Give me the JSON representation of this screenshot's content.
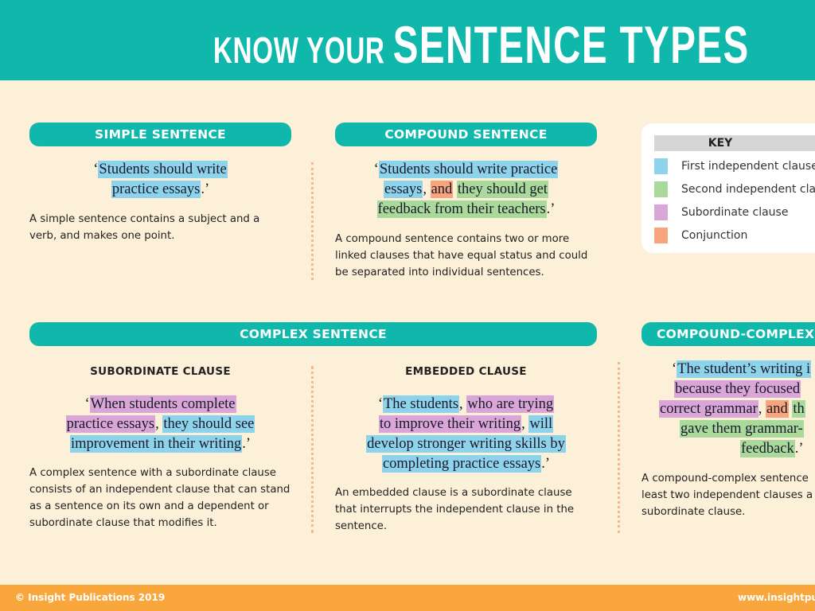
{
  "header": {
    "title_small": "KNOW YOUR",
    "title_large": "SENTENCE TYPES"
  },
  "colors": {
    "teal": "#10b8ab",
    "background": "#fdf0d9",
    "first_independent": "#8ed3ec",
    "second_independent": "#a9d99b",
    "subordinate": "#d9a6d7",
    "conjunction": "#f7a57c",
    "footer": "#f9a73c"
  },
  "simple": {
    "heading": "SIMPLE SENTENCE",
    "quote": [
      [
        {
          "t": "‘",
          "c": ""
        },
        {
          "t": "Students should write",
          "c": "first"
        }
      ],
      [
        {
          "t": "practice essays",
          "c": "first"
        },
        {
          "t": ".’",
          "c": ""
        }
      ]
    ],
    "description": "A simple sentence contains a subject and a verb, and makes one point."
  },
  "compound": {
    "heading": "COMPOUND SENTENCE",
    "quote": [
      [
        {
          "t": "‘",
          "c": ""
        },
        {
          "t": "Students should write practice",
          "c": "first"
        }
      ],
      [
        {
          "t": "essays",
          "c": "first"
        },
        {
          "t": ", ",
          "c": ""
        },
        {
          "t": "and",
          "c": "conj"
        },
        {
          "t": " ",
          "c": ""
        },
        {
          "t": "they should get",
          "c": "second"
        }
      ],
      [
        {
          "t": "feedback from their teachers",
          "c": "second"
        },
        {
          "t": ".’",
          "c": ""
        }
      ]
    ],
    "description": "A compound sentence contains two or more linked clauses that have equal status and could be separated into individual sentences."
  },
  "key": {
    "heading": "KEY",
    "items": [
      {
        "label": "First independent clause",
        "c": "first"
      },
      {
        "label": "Second independent clause",
        "c": "second"
      },
      {
        "label": "Subordinate clause",
        "c": "sub"
      },
      {
        "label": "Conjunction",
        "c": "conj"
      }
    ]
  },
  "complex": {
    "heading": "COMPLEX SENTENCE",
    "subordinate": {
      "heading": "SUBORDINATE CLAUSE",
      "quote": [
        [
          {
            "t": "‘",
            "c": ""
          },
          {
            "t": "When students complete",
            "c": "sub"
          }
        ],
        [
          {
            "t": "practice essays",
            "c": "sub"
          },
          {
            "t": ", ",
            "c": ""
          },
          {
            "t": "they should see",
            "c": "first"
          }
        ],
        [
          {
            "t": "improvement in their writing",
            "c": "first"
          },
          {
            "t": ".’",
            "c": ""
          }
        ]
      ],
      "description": "A complex sentence with a subordinate clause consists of an independent clause that can stand as a sentence on its own and a dependent or subordinate clause that modifies it."
    },
    "embedded": {
      "heading": "EMBEDDED CLAUSE",
      "quote": [
        [
          {
            "t": "‘",
            "c": ""
          },
          {
            "t": "The students",
            "c": "first"
          },
          {
            "t": ", ",
            "c": ""
          },
          {
            "t": "who are trying",
            "c": "sub"
          }
        ],
        [
          {
            "t": "to improve their writing",
            "c": "sub"
          },
          {
            "t": ", ",
            "c": ""
          },
          {
            "t": "will",
            "c": "first"
          }
        ],
        [
          {
            "t": "develop stronger writing skills by",
            "c": "first"
          }
        ],
        [
          {
            "t": "completing practice essays",
            "c": "first"
          },
          {
            "t": ".’",
            "c": ""
          }
        ]
      ],
      "description": "An embedded clause is a subordinate clause that interrupts the independent clause in the sentence."
    }
  },
  "compound_complex": {
    "heading": "COMPOUND-COMPLEX S",
    "quote": [
      [
        {
          "t": "‘",
          "c": ""
        },
        {
          "t": "The student’s writing i",
          "c": "first"
        }
      ],
      [
        {
          "t": "because they focused",
          "c": "sub"
        }
      ],
      [
        {
          "t": "correct grammar",
          "c": "sub"
        },
        {
          "t": ", ",
          "c": ""
        },
        {
          "t": "and",
          "c": "conj"
        },
        {
          "t": " ",
          "c": ""
        },
        {
          "t": "th",
          "c": "second"
        }
      ],
      [
        {
          "t": "gave them grammar-",
          "c": "second"
        }
      ],
      [
        {
          "t": "feedback",
          "c": "second"
        },
        {
          "t": ".’",
          "c": ""
        }
      ]
    ],
    "description": "A compound-complex sentence least two independent clauses a subordinate clause."
  },
  "footer": {
    "copyright": "© Insight Publications 2019",
    "website": "www.insightpub"
  }
}
